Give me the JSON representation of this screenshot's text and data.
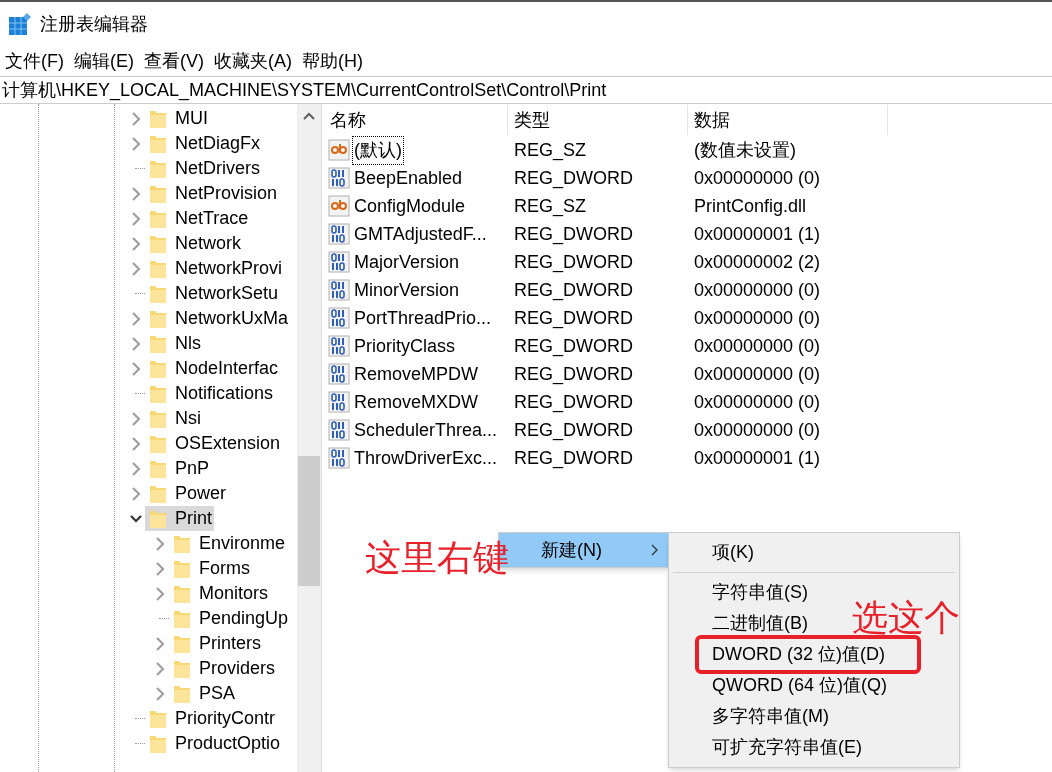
{
  "window": {
    "title": "注册表编辑器"
  },
  "menu_bar": [
    "文件(F)",
    "编辑(E)",
    "查看(V)",
    "收藏夹(A)",
    "帮助(H)"
  ],
  "address_bar": "计算机\\HKEY_LOCAL_MACHINE\\SYSTEM\\CurrentControlSet\\Control\\Print",
  "tree": [
    {
      "label": "MUI",
      "kind": "collapsed",
      "selected": false
    },
    {
      "label": "NetDiagFx",
      "kind": "collapsed",
      "selected": false
    },
    {
      "label": "NetDrivers",
      "kind": "leaf",
      "selected": false
    },
    {
      "label": "NetProvision",
      "kind": "collapsed",
      "selected": false
    },
    {
      "label": "NetTrace",
      "kind": "collapsed",
      "selected": false
    },
    {
      "label": "Network",
      "kind": "collapsed",
      "selected": false
    },
    {
      "label": "NetworkProvi",
      "kind": "collapsed",
      "selected": false
    },
    {
      "label": "NetworkSetu",
      "kind": "leaf",
      "selected": false
    },
    {
      "label": "NetworkUxMa",
      "kind": "collapsed",
      "selected": false
    },
    {
      "label": "Nls",
      "kind": "collapsed",
      "selected": false
    },
    {
      "label": "NodeInterfac",
      "kind": "collapsed",
      "selected": false
    },
    {
      "label": "Notifications",
      "kind": "leaf",
      "selected": false
    },
    {
      "label": "Nsi",
      "kind": "collapsed",
      "selected": false
    },
    {
      "label": "OSExtension",
      "kind": "collapsed",
      "selected": false
    },
    {
      "label": "PnP",
      "kind": "collapsed",
      "selected": false
    },
    {
      "label": "Power",
      "kind": "collapsed",
      "selected": false
    },
    {
      "label": "Print",
      "kind": "expanded",
      "selected": true,
      "children": [
        {
          "label": "Environme",
          "kind": "collapsed",
          "selected": false
        },
        {
          "label": "Forms",
          "kind": "collapsed",
          "selected": false
        },
        {
          "label": "Monitors",
          "kind": "collapsed",
          "selected": false
        },
        {
          "label": "PendingUp",
          "kind": "leaf",
          "selected": false
        },
        {
          "label": "Printers",
          "kind": "collapsed",
          "selected": false
        },
        {
          "label": "Providers",
          "kind": "collapsed",
          "selected": false
        },
        {
          "label": "PSA",
          "kind": "collapsed",
          "selected": false
        }
      ]
    },
    {
      "label": "PriorityContr",
      "kind": "leaf",
      "selected": false
    },
    {
      "label": "ProductOptio",
      "kind": "leaf",
      "selected": false
    }
  ],
  "table": {
    "columns": [
      "名称",
      "类型",
      "数据"
    ],
    "rows": [
      {
        "kind": "string",
        "name": "(默认)",
        "type": "REG_SZ",
        "data": "(数值未设置)",
        "focused": true
      },
      {
        "kind": "binary",
        "name": "BeepEnabled",
        "type": "REG_DWORD",
        "data": "0x00000000 (0)",
        "focused": false
      },
      {
        "kind": "string",
        "name": "ConfigModule",
        "type": "REG_SZ",
        "data": "PrintConfig.dll",
        "focused": false
      },
      {
        "kind": "binary",
        "name": "GMTAdjustedF...",
        "type": "REG_DWORD",
        "data": "0x00000001 (1)",
        "focused": false
      },
      {
        "kind": "binary",
        "name": "MajorVersion",
        "type": "REG_DWORD",
        "data": "0x00000002 (2)",
        "focused": false
      },
      {
        "kind": "binary",
        "name": "MinorVersion",
        "type": "REG_DWORD",
        "data": "0x00000000 (0)",
        "focused": false
      },
      {
        "kind": "binary",
        "name": "PortThreadPrio...",
        "type": "REG_DWORD",
        "data": "0x00000000 (0)",
        "focused": false
      },
      {
        "kind": "binary",
        "name": "PriorityClass",
        "type": "REG_DWORD",
        "data": "0x00000000 (0)",
        "focused": false
      },
      {
        "kind": "binary",
        "name": "RemoveMPDW",
        "type": "REG_DWORD",
        "data": "0x00000000 (0)",
        "focused": false
      },
      {
        "kind": "binary",
        "name": "RemoveMXDW",
        "type": "REG_DWORD",
        "data": "0x00000000 (0)",
        "focused": false
      },
      {
        "kind": "binary",
        "name": "SchedulerThrea...",
        "type": "REG_DWORD",
        "data": "0x00000000 (0)",
        "focused": false
      },
      {
        "kind": "binary",
        "name": "ThrowDriverExc...",
        "type": "REG_DWORD",
        "data": "0x00000001 (1)",
        "focused": false
      }
    ]
  },
  "context_menu": {
    "items": [
      {
        "label": "新建(N)",
        "selected": true,
        "submenu": true
      }
    ]
  },
  "submenu": {
    "groups": [
      [
        {
          "label": "项(K)",
          "highlighted": false
        }
      ],
      [
        {
          "label": "字符串值(S)",
          "highlighted": false
        },
        {
          "label": "二进制值(B)",
          "highlighted": false
        },
        {
          "label": "DWORD (32 位)值(D)",
          "highlighted": true
        },
        {
          "label": "QWORD (64 位)值(Q)",
          "highlighted": false
        },
        {
          "label": "多字符串值(M)",
          "highlighted": false
        },
        {
          "label": "可扩充字符串值(E)",
          "highlighted": false
        }
      ]
    ]
  },
  "annotations": [
    "这里右键",
    "选这个"
  ]
}
